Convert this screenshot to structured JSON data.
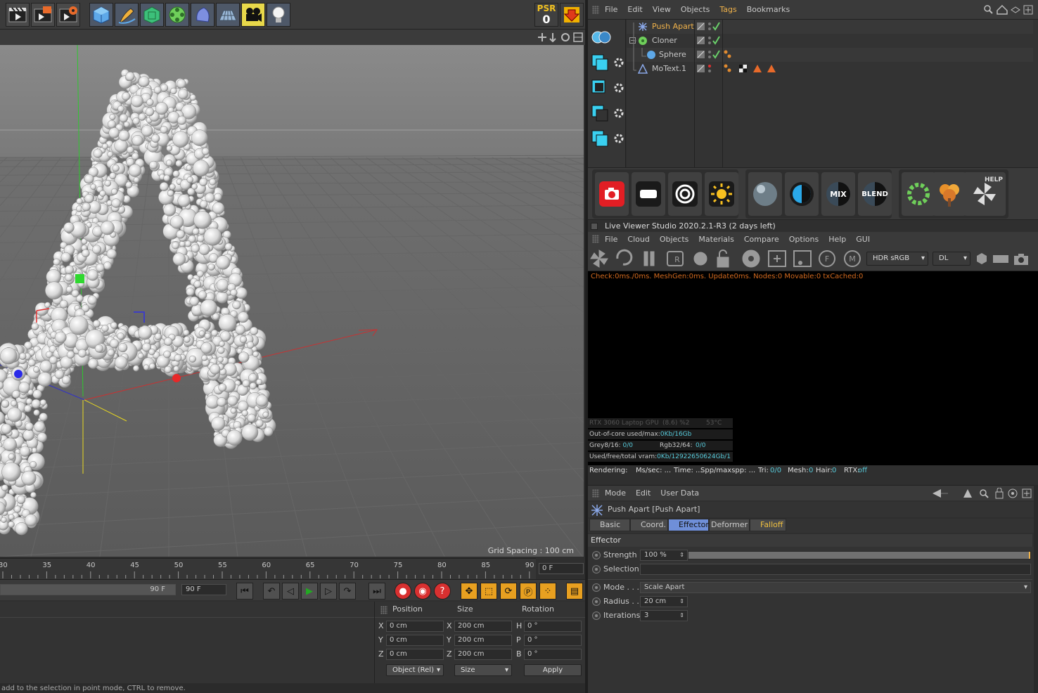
{
  "toolbar": {
    "icons": [
      "render-view-icon",
      "render-picture-viewer-icon",
      "render-settings-icon",
      "cube-icon",
      "pen-icon",
      "subdivision-icon",
      "cloner-icon",
      "deformer-icon",
      "floor-icon",
      "camera-icon",
      "light-icon"
    ],
    "psr_label": "PSR",
    "psr_value": "0"
  },
  "viewport": {
    "grid_spacing": "Grid Spacing : 100 cm"
  },
  "timeline": {
    "ticks": [
      "30",
      "35",
      "40",
      "45",
      "50",
      "55",
      "60",
      "65",
      "70",
      "75",
      "80",
      "85",
      "90"
    ],
    "current_frame": "0 F",
    "end_frame_a": "90 F",
    "end_frame_b": "90 F"
  },
  "coordinates": {
    "headers": {
      "position": "Position",
      "size": "Size",
      "rotation": "Rotation"
    },
    "rows": [
      {
        "axis": "X",
        "pos": "0 cm",
        "saxis": "X",
        "size": "200 cm",
        "raxis": "H",
        "rot": "0 °"
      },
      {
        "axis": "Y",
        "pos": "0 cm",
        "saxis": "Y",
        "size": "200 cm",
        "raxis": "P",
        "rot": "0 °"
      },
      {
        "axis": "Z",
        "pos": "0 cm",
        "saxis": "Z",
        "size": "200 cm",
        "raxis": "B",
        "rot": "0 °"
      }
    ],
    "mode_dropdown": "Object (Rel)",
    "size_dropdown": "Size",
    "apply": "Apply"
  },
  "statusbar": "add to the selection in point mode, CTRL to remove.",
  "object_manager": {
    "menu": [
      "File",
      "Edit",
      "View",
      "Objects",
      "Tags",
      "Bookmarks"
    ],
    "active_menu": "Tags",
    "objects": [
      {
        "name": "Push Apart",
        "selected": true
      },
      {
        "name": "Cloner",
        "selected": false
      },
      {
        "name": "Sphere",
        "selected": false
      },
      {
        "name": "MoText.1",
        "selected": false
      }
    ]
  },
  "shelf": {
    "buttons": [
      "octane-camera-icon",
      "octane-arealight-icon",
      "octane-targetlight-icon",
      "octane-daylight-icon",
      "material-sphere-icon",
      "contrast-icon",
      "mix-material-icon",
      "blend-material-icon",
      "scatter-icon",
      "tree-icon",
      "octane-help-icon"
    ],
    "mix_label": "MIX",
    "blend_label": "BLEND",
    "help_label": "HELP"
  },
  "live_viewer": {
    "title": "Live Viewer Studio 2020.2.1-R3 (2 days left)",
    "menu": [
      "File",
      "Cloud",
      "Objects",
      "Materials",
      "Compare",
      "Options",
      "Help",
      "GUI"
    ],
    "color_space": "HDR sRGB",
    "render_mode": "DL",
    "log": "Check:0ms./0ms. MeshGen:0ms. Update0ms. Nodes:0 Movable:0 txCached:0",
    "gpu": "RTX 3060 Laptop GPU",
    "gpu_usage": "(8.6) %2",
    "gpu_temp": "53°C",
    "out_of_core_label": "Out-of-core used/max:",
    "out_of_core_value": "0Kb/16Gb",
    "grey_label": "Grey8/16:",
    "grey_value": "0/0",
    "rgb_label": "Rgb32/64:",
    "rgb_value": "0/0",
    "vram_label": "Used/free/total vram:",
    "vram_value": "0Kb/12922650624Gb/1",
    "status": {
      "rendering": "Rendering:",
      "ms": "Ms/sec: ...",
      "time": "Time: ...",
      "spp": "Spp/maxspp: ...",
      "tri_label": "Tri:",
      "tri": "0/0",
      "mesh_label": "Mesh:",
      "mesh": "0",
      "hair_label": "Hair:",
      "hair": "0",
      "rtx_label": "RTX:",
      "rtx": "off"
    }
  },
  "attributes": {
    "menu": [
      "Mode",
      "Edit",
      "User Data"
    ],
    "title": "Push Apart [Push Apart]",
    "tabs": [
      "Basic",
      "Coord.",
      "Effector",
      "Deformer",
      "Falloff"
    ],
    "active_tab": "Effector",
    "section": "Effector",
    "strength_label": "Strength",
    "strength_value": "100 %",
    "strength_fraction": 1.0,
    "selection_label": "Selection",
    "mode_label": "Mode . . .",
    "mode_value": "Scale Apart",
    "radius_label": "Radius . .",
    "radius_value": "20 cm",
    "iterations_label": "Iterations",
    "iterations_value": "3"
  },
  "colors": {
    "accent_blue": "#6f8fd8",
    "selected_orange": "#f0b24a",
    "check_green": "#6ad06a",
    "log_orange": "#d2691e",
    "value_cyan": "#56c8d8"
  }
}
